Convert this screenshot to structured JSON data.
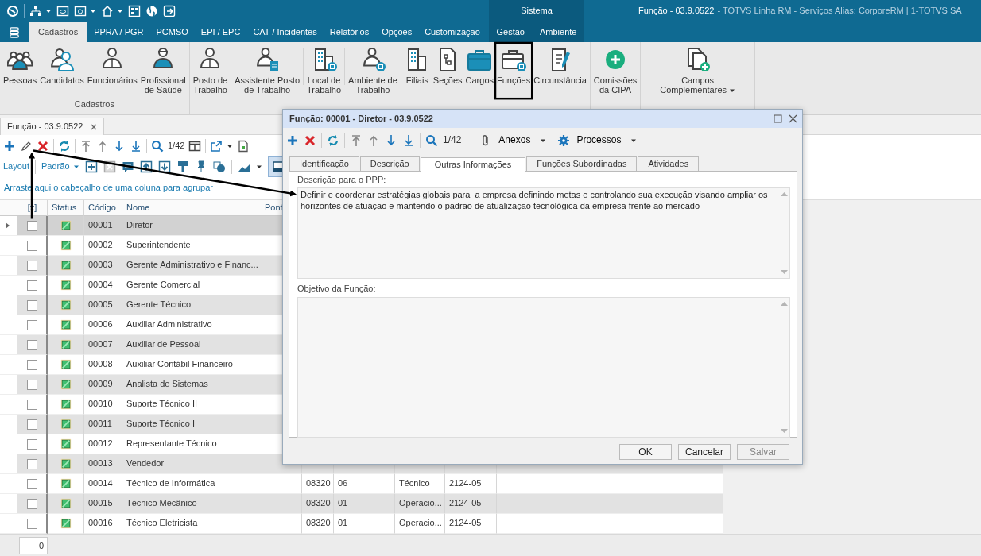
{
  "titlebar": {
    "context_label": "Sistema",
    "title": "Função - 03.9.0522",
    "app_info": "- TOTVS Linha RM - Serviços  Alias: CorporeRM | 1-TOTVS SA"
  },
  "ribbon_tabs": [
    {
      "label": "Cadastros",
      "selected": true,
      "contextual": false
    },
    {
      "label": "PPRA / PGR",
      "selected": false,
      "contextual": false
    },
    {
      "label": "PCMSO",
      "selected": false,
      "contextual": false
    },
    {
      "label": "EPI / EPC",
      "selected": false,
      "contextual": false
    },
    {
      "label": "CAT / Incidentes",
      "selected": false,
      "contextual": false
    },
    {
      "label": "Relatórios",
      "selected": false,
      "contextual": false
    },
    {
      "label": "Opções",
      "selected": false,
      "contextual": false
    },
    {
      "label": "Customização",
      "selected": false,
      "contextual": false
    },
    {
      "label": "Gestão",
      "selected": false,
      "contextual": true
    },
    {
      "label": "Ambiente",
      "selected": false,
      "contextual": true
    }
  ],
  "ribbon_groups": [
    {
      "label": "Cadastros",
      "buttons": [
        {
          "label": "Pessoas",
          "dropdown": false
        },
        {
          "label": "Candidatos",
          "dropdown": false
        },
        {
          "label": "Funcionários",
          "dropdown": false
        },
        {
          "label": "Profissional\nde Saúde",
          "dropdown": false
        }
      ]
    },
    {
      "buttons": [
        {
          "label": "Posto de\nTrabalho",
          "dropdown": false
        },
        {
          "label": "Assistente Posto\nde Trabalho",
          "dropdown": false
        },
        {
          "label": "Local de\nTrabalho",
          "dropdown": false
        },
        {
          "label": "Ambiente de\nTrabalho",
          "dropdown": false
        },
        {
          "label": "Filiais",
          "dropdown": false
        },
        {
          "label": "Seções",
          "dropdown": false
        },
        {
          "label": "Cargos",
          "dropdown": false
        },
        {
          "label": "Funções",
          "dropdown": false
        },
        {
          "label": "Circunstância",
          "dropdown": false
        }
      ]
    },
    {
      "buttons": [
        {
          "label": "Comissões\nda CIPA",
          "dropdown": false
        }
      ]
    },
    {
      "buttons": [
        {
          "label": "Campos\nComplementares",
          "dropdown": true
        }
      ]
    }
  ],
  "document_tab": {
    "label": "Função - 03.9.0522"
  },
  "toolbar": {
    "counter": "1/42"
  },
  "layout_bar": {
    "layout": "Layout",
    "preset": "Padrão"
  },
  "group_hint": "Arraste aqui o cabeçalho de uma coluna para agrupar",
  "grid": {
    "columns": [
      "[x]",
      "Status",
      "Código",
      "Nome",
      "Pont"
    ],
    "rows": [
      {
        "code": "00001",
        "name": "Diretor",
        "checked": false,
        "selected": true
      },
      {
        "code": "00002",
        "name": "Superintendente",
        "checked": false,
        "selected": false
      },
      {
        "code": "00003",
        "name": "Gerente Administrativo e Financ...",
        "checked": false,
        "selected": false
      },
      {
        "code": "00004",
        "name": "Gerente Comercial",
        "checked": false,
        "selected": false
      },
      {
        "code": "00005",
        "name": "Gerente Técnico",
        "checked": false,
        "selected": false
      },
      {
        "code": "00006",
        "name": "Auxiliar Administrativo",
        "checked": false,
        "selected": false
      },
      {
        "code": "00007",
        "name": "Auxiliar de Pessoal",
        "checked": false,
        "selected": false
      },
      {
        "code": "00008",
        "name": "Auxiliar Contábil Financeiro",
        "checked": false,
        "selected": false
      },
      {
        "code": "00009",
        "name": "Analista de Sistemas",
        "checked": false,
        "selected": false
      },
      {
        "code": "00010",
        "name": "Suporte Técnico II",
        "checked": false,
        "selected": false
      },
      {
        "code": "00011",
        "name": "Suporte Técnico I",
        "checked": false,
        "selected": false
      },
      {
        "code": "00012",
        "name": "Representante Técnico",
        "checked": false,
        "selected": false
      },
      {
        "code": "00013",
        "name": "Vendedor",
        "checked": false,
        "selected": false
      },
      {
        "code": "00014",
        "name": "Técnico de Informática",
        "checked": false,
        "selected": false,
        "extra": [
          "08320",
          "06",
          "Técnico",
          "2124-05"
        ]
      },
      {
        "code": "00015",
        "name": "Técnico Mecânico",
        "checked": false,
        "selected": false,
        "extra": [
          "08320",
          "01",
          "Operacio...",
          "2124-05"
        ]
      },
      {
        "code": "00016",
        "name": "Técnico Eletricista",
        "checked": false,
        "selected": false,
        "extra": [
          "08320",
          "01",
          "Operacio...",
          "2124-05"
        ]
      }
    ]
  },
  "status_bar": {
    "count": "0"
  },
  "dialog": {
    "title": "Função: 00001 - Diretor - 03.9.0522",
    "counter": "1/42",
    "attachments": "Anexos",
    "processes": "Processos",
    "tabs": [
      {
        "label": "Identificação",
        "selected": false
      },
      {
        "label": "Descrição",
        "selected": false
      },
      {
        "label": "Outras Informações",
        "selected": true
      },
      {
        "label": "Funções Subordinadas",
        "selected": false
      },
      {
        "label": "Atividades",
        "selected": false
      }
    ],
    "fields": [
      {
        "label": "Descrição para o PPP:",
        "value": "Definir e coordenar estratégias globais para  a empresa definindo metas e controlando sua execução visando ampliar os horizontes de atuação e mantendo o padrão de atualização tecnológica da empresa frente ao mercado"
      },
      {
        "label": "Objetivo da Função:"
      }
    ],
    "buttons": [
      {
        "label": "OK",
        "disabled": false
      },
      {
        "label": "Cancelar",
        "disabled": false
      },
      {
        "label": "Salvar",
        "disabled": true
      }
    ]
  }
}
